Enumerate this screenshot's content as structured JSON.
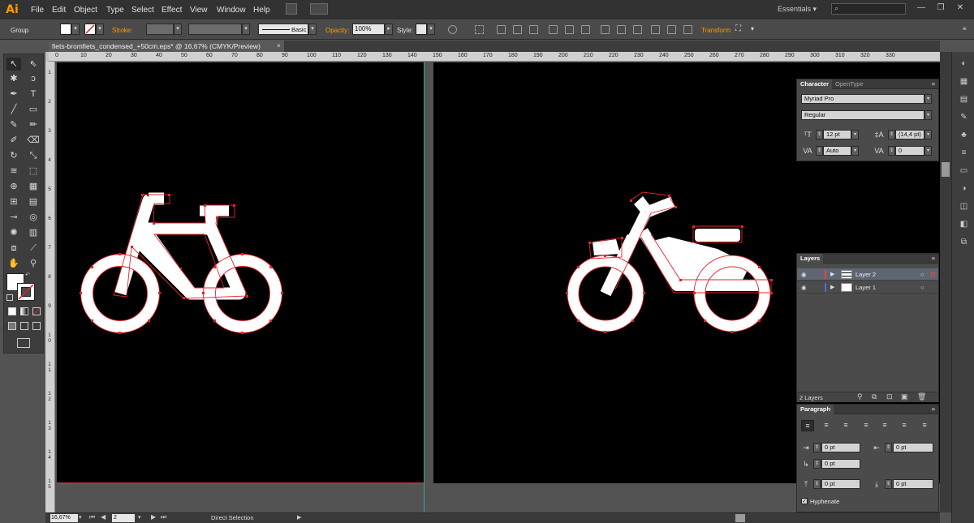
{
  "app": {
    "logo": "Ai"
  },
  "menu": [
    "File",
    "Edit",
    "Object",
    "Type",
    "Select",
    "Effect",
    "View",
    "Window",
    "Help"
  ],
  "workspace": {
    "label": "Essentials",
    "search_placeholder": ""
  },
  "control_bar": {
    "selection_label": "Group",
    "stroke_label": "Stroke:",
    "brush_label": "Basic",
    "opacity_label": "Opacity:",
    "opacity_value": "100%",
    "style_label": "Style:",
    "transform_label": "Transform"
  },
  "document": {
    "tab_title": "fiets-bromfiets_condensed_+50cm.eps* @ 16,67% (CMYK/Preview)",
    "close": "×",
    "zoom": "16,67%",
    "page": "2",
    "status": "Direct Selection"
  },
  "ruler_h": [
    "0",
    "10",
    "20",
    "30",
    "40",
    "50",
    "60",
    "70",
    "80",
    "90",
    "100",
    "110",
    "120",
    "130",
    "140",
    "150",
    "160",
    "170",
    "180",
    "190",
    "200",
    "210",
    "220",
    "230",
    "240",
    "250",
    "260",
    "270",
    "280",
    "290",
    "300",
    "310",
    "320",
    "330"
  ],
  "ruler_v": [
    "1",
    "2",
    "3",
    "4",
    "5",
    "6",
    "7",
    "8",
    "9",
    "1 0",
    "1 1",
    "1 2",
    "1 3",
    "1 4",
    "1 5"
  ],
  "character_panel": {
    "tabs": [
      "Character",
      "OpenType"
    ],
    "font_family": "Myriad Pro",
    "font_style": "Regular",
    "font_size": "12 pt",
    "leading": "(14,4 pt)",
    "kerning": "Auto",
    "tracking": "0"
  },
  "layers_panel": {
    "title": "Layers",
    "layers": [
      {
        "name": "Layer 2",
        "color": "#e8453c",
        "selected": true
      },
      {
        "name": "Layer 1",
        "color": "#4a6ee0",
        "selected": false
      }
    ],
    "count": "2 Layers"
  },
  "paragraph_panel": {
    "title": "Paragraph",
    "left_indent": "0 pt",
    "right_indent": "0 pt",
    "first_line_indent": "0 pt",
    "space_before": "0 pt",
    "space_after": "0 pt",
    "hyphenate_label": "Hyphenate",
    "hyphenate_checked": true
  },
  "artwork": {
    "selection_color": "#e8202a"
  }
}
